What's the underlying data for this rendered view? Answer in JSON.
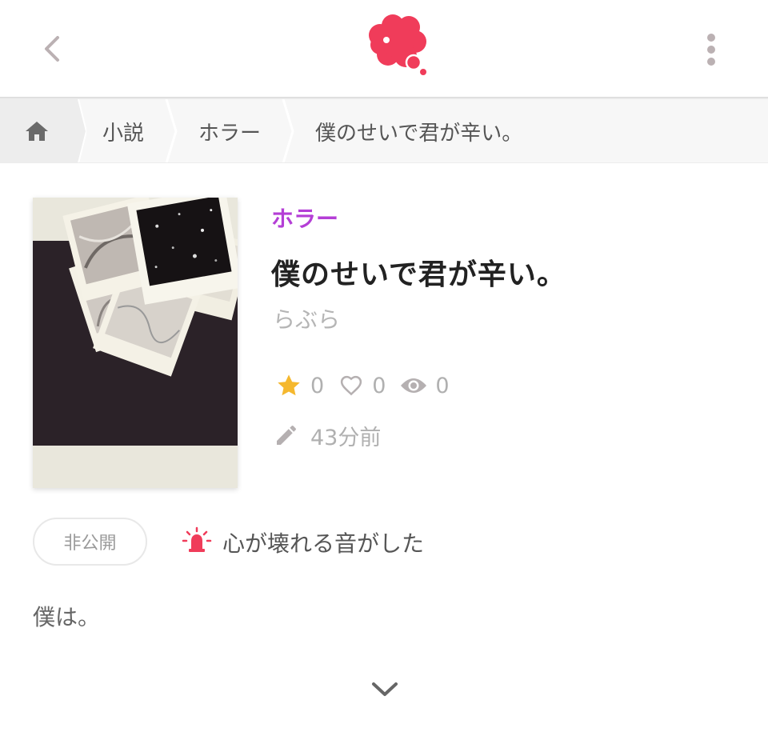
{
  "header": {
    "back_icon": "chevron-left-icon",
    "logo_icon": "red-cloud-logo",
    "more_icon": "vertical-dots-icon",
    "brand_color": "#f03c5a"
  },
  "breadcrumb": {
    "home_icon": "home-icon",
    "items": [
      {
        "label": "小説"
      },
      {
        "label": "ホラー"
      },
      {
        "label": "僕のせいで君が辛い。"
      }
    ]
  },
  "book": {
    "genre": "ホラー",
    "genre_color": "#b43ed6",
    "title": "僕のせいで君が辛い。",
    "author": "らぶら",
    "stats": {
      "stars": "0",
      "likes": "0",
      "views": "0"
    },
    "updated": "43分前"
  },
  "badges": {
    "visibility": "非公開",
    "catchphrase": "心が壊れる音がした"
  },
  "content": {
    "preview": "僕は。"
  }
}
